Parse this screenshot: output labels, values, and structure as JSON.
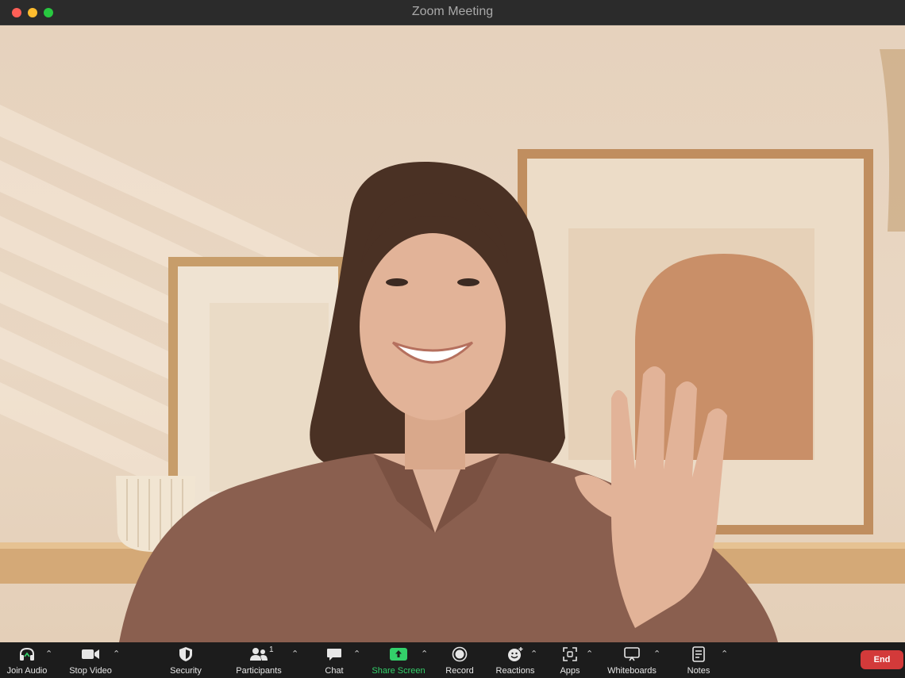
{
  "window": {
    "title": "Zoom Meeting"
  },
  "colors": {
    "accent_green": "#33d06a",
    "end_red": "#d33a3a",
    "toolbar_bg": "#1c1c1c"
  },
  "video": {
    "description_icon": "video-feed"
  },
  "toolbar": {
    "join_audio": {
      "label": "Join Audio",
      "icon": "headphones-icon"
    },
    "stop_video": {
      "label": "Stop Video",
      "icon": "video-camera-icon"
    },
    "security": {
      "label": "Security",
      "icon": "shield-icon"
    },
    "participants": {
      "label": "Participants",
      "icon": "people-icon",
      "count": "1"
    },
    "chat": {
      "label": "Chat",
      "icon": "chat-bubble-icon"
    },
    "share_screen": {
      "label": "Share Screen",
      "icon": "share-arrow-icon"
    },
    "record": {
      "label": "Record",
      "icon": "record-icon"
    },
    "reactions": {
      "label": "Reactions",
      "icon": "smiley-icon"
    },
    "apps": {
      "label": "Apps",
      "icon": "apps-icon"
    },
    "whiteboards": {
      "label": "Whiteboards",
      "icon": "whiteboard-icon"
    },
    "notes": {
      "label": "Notes",
      "icon": "notes-icon"
    },
    "end": {
      "label": "End"
    }
  }
}
